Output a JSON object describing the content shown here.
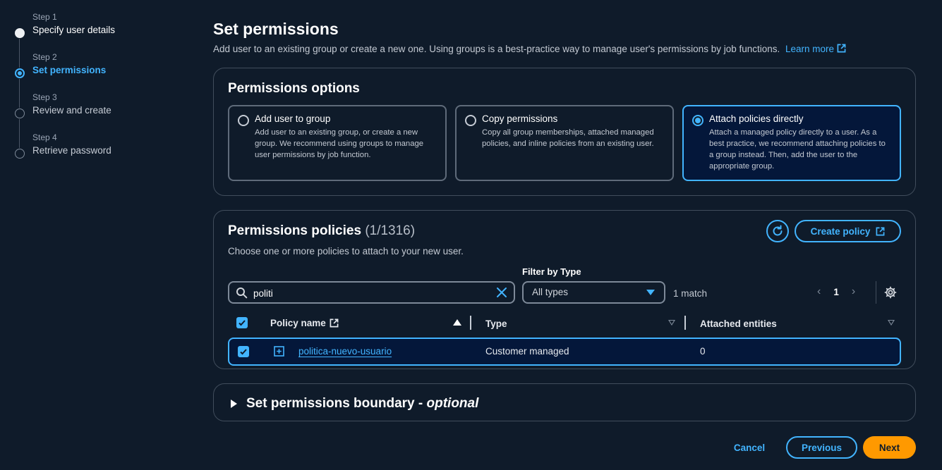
{
  "steps": [
    {
      "num": "Step 1",
      "label": "Specify user details"
    },
    {
      "num": "Step 2",
      "label": "Set permissions"
    },
    {
      "num": "Step 3",
      "label": "Review and create"
    },
    {
      "num": "Step 4",
      "label": "Retrieve password"
    }
  ],
  "header": {
    "title": "Set permissions",
    "description": "Add user to an existing group or create a new one. Using groups is a best-practice way to manage user's permissions by job functions.",
    "learn_more": "Learn more"
  },
  "options": {
    "title": "Permissions options",
    "items": [
      {
        "title": "Add user to group",
        "desc": "Add user to an existing group, or create a new group. We recommend using groups to manage user permissions by job function."
      },
      {
        "title": "Copy permissions",
        "desc": "Copy all group memberships, attached managed policies, and inline policies from an existing user."
      },
      {
        "title": "Attach policies directly",
        "desc": "Attach a managed policy directly to a user. As a best practice, we recommend attaching policies to a group instead. Then, add the user to the appropriate group."
      }
    ],
    "selected": "Attach policies directly"
  },
  "policies": {
    "title": "Permissions policies",
    "count": "(1/1316)",
    "subtitle": "Choose one or more policies to attach to your new user.",
    "create_policy": "Create policy",
    "filter_label": "Filter by Type",
    "search_value": "politi",
    "filter_value": "All types",
    "match_text": "1 match",
    "page": "1",
    "columns": {
      "name": "Policy name",
      "type": "Type",
      "entities": "Attached entities"
    },
    "rows": [
      {
        "name": "politica-nuevo-usuario",
        "type": "Customer managed",
        "entities": "0",
        "checked": true
      }
    ]
  },
  "boundary": {
    "title": "Set permissions boundary - ",
    "optional": "optional"
  },
  "footer": {
    "cancel": "Cancel",
    "previous": "Previous",
    "next": "Next"
  },
  "colors": {
    "background": "#0f1b2a",
    "accent": "#42b4ff",
    "primary_button": "#ff9900",
    "selected_bg": "#04173a"
  }
}
